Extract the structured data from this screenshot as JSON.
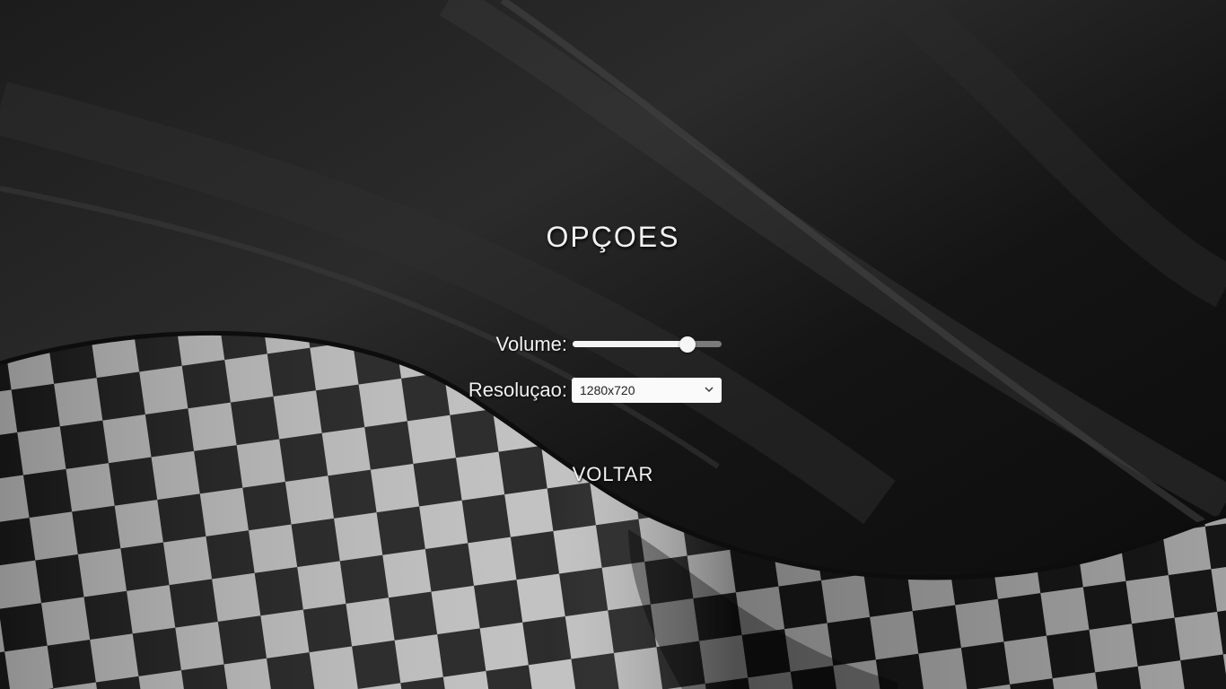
{
  "menu": {
    "title": "OPÇOES",
    "volume": {
      "label": "Volume:",
      "value_fraction": 0.77
    },
    "resolution": {
      "label": "Resoluçao:",
      "selected": "1280x720"
    },
    "back_label": "VOLTAR"
  },
  "icons": {
    "dropdown": "chevron-down-icon"
  },
  "colors": {
    "text": "#f2f2f2",
    "background": "#111111",
    "slider_track": "#7a7a7a",
    "slider_fill": "#f4f4f4"
  }
}
